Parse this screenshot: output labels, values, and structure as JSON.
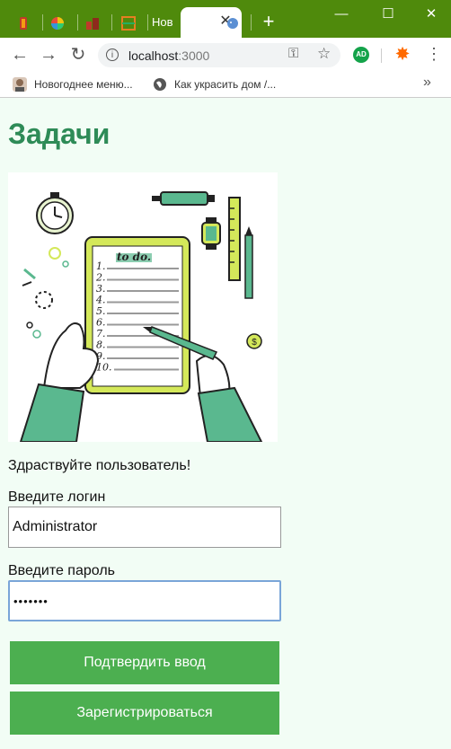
{
  "browser": {
    "active_tab_title": "Нов",
    "new_tab_symbol": "+",
    "window_controls": {
      "minimize": "—",
      "maximize": "☐",
      "close": "✕"
    },
    "nav": {
      "back": "←",
      "forward": "→",
      "reload": "↻"
    },
    "address": {
      "host": "localhost",
      "port": ":3000"
    },
    "extension_ad_label": "AD",
    "bookmarks": [
      {
        "label": "Новогоднее меню..."
      },
      {
        "label": "Как украсить дом /..."
      }
    ],
    "bookmarks_more": "»"
  },
  "page": {
    "title": "Задачи",
    "illustration_heading": "to do.",
    "illustration_items": [
      "1.",
      "2.",
      "3.",
      "4.",
      "5.",
      "6.",
      "7.",
      "8.",
      "9.",
      "10."
    ],
    "greeting": "Здраствуйте пользователь!",
    "login_label": "Введите логин",
    "login_value": "Administrator",
    "password_label": "Введите пароль",
    "password_value": "•••••••",
    "submit_button": "Подтвердить ввод",
    "register_button": "Зарегистрироваться"
  },
  "colors": {
    "title_green": "#2e8b57",
    "button_green": "#4caf50",
    "page_bg": "#f2fdf5",
    "titlebar_green": "#4f8a0c"
  }
}
